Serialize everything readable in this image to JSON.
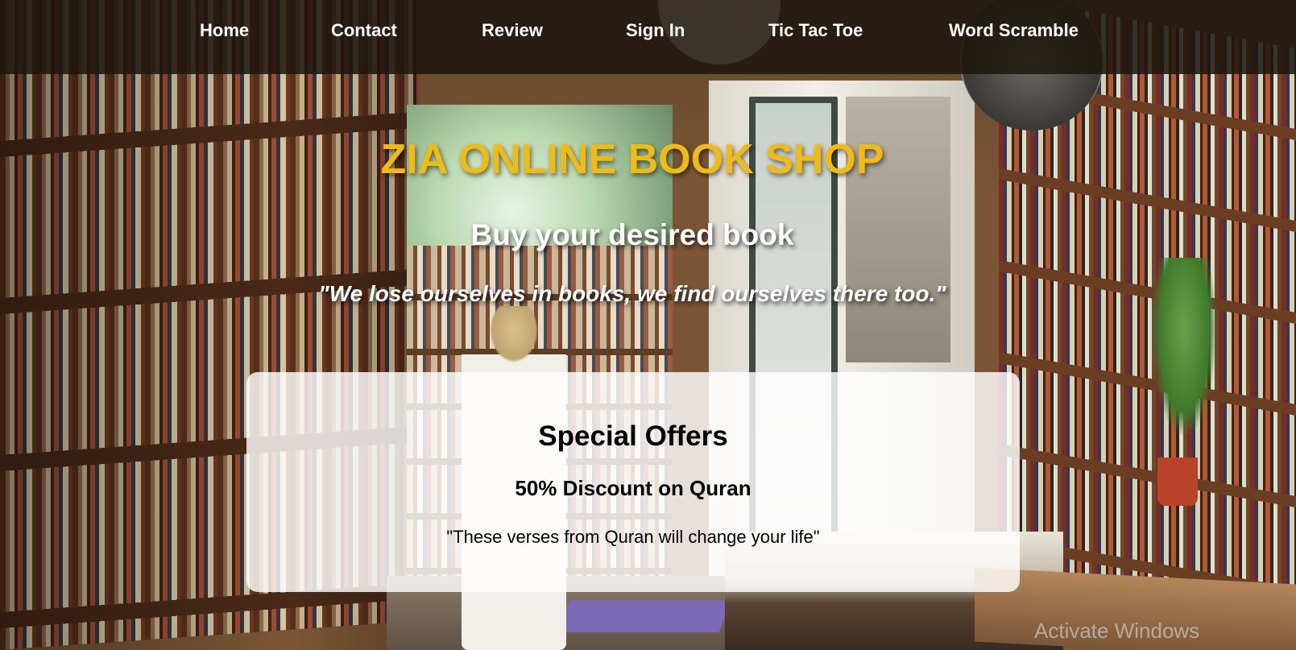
{
  "nav": {
    "home": "Home",
    "contact": "Contact",
    "review": "Review",
    "sign_in": "Sign In",
    "tic_tac_toe": "Tic Tac Toe",
    "word_scramble": "Word Scramble"
  },
  "hero": {
    "title": "ZIA ONLINE BOOK SHOP",
    "subtitle": "Buy your desired book",
    "quote": "\"We lose ourselves in books, we find ourselves there too.\""
  },
  "offers": {
    "heading": "Special Offers",
    "item": "50% Discount on Quran",
    "quote": "\"These verses from Quran will change your life\""
  },
  "watermark": "Activate Windows",
  "colors": {
    "title": "#f1bb16",
    "navbar": "#1e160e",
    "card": "#ffffff"
  }
}
